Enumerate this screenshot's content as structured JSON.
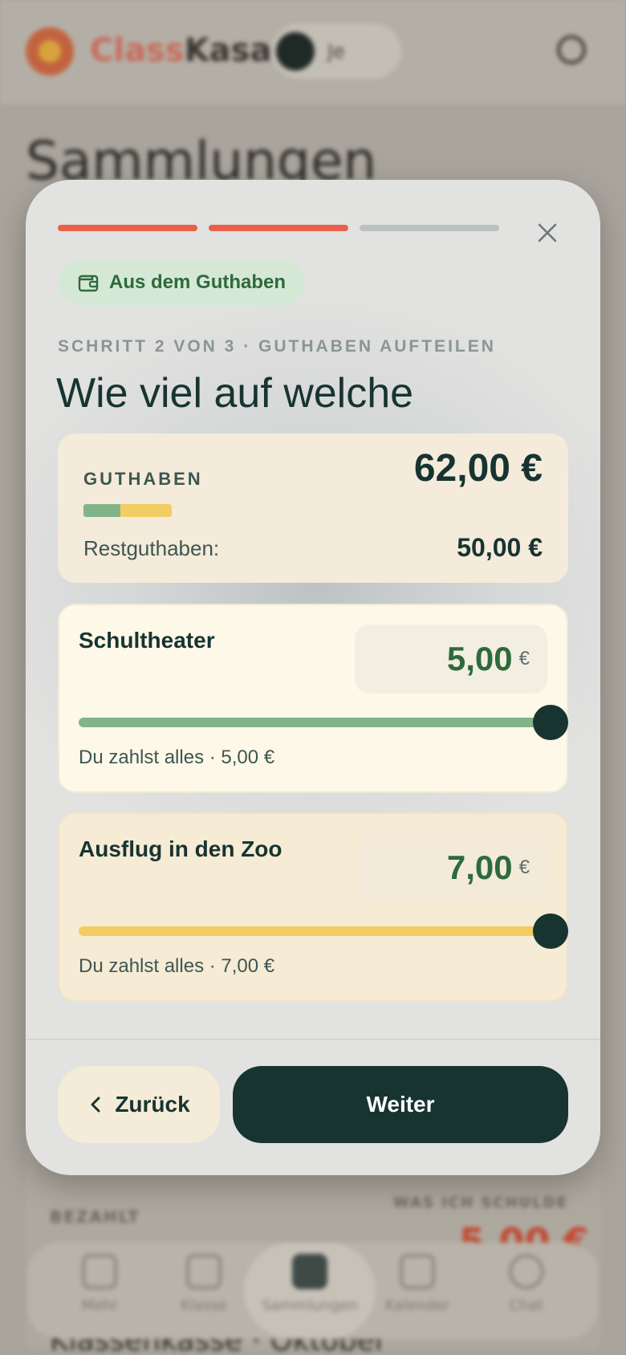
{
  "background": {
    "logo_part1": "Class",
    "logo_part2": "Kasa",
    "profile_pill_text": "Je",
    "page_title": "Sammlungen",
    "summary_left_label": "BEZAHLT",
    "summary_right_label": "WAS ICH SCHULDE",
    "summary_right_value": "5,00 €",
    "card_title": "Klassenkasse · Oktober",
    "nav": [
      {
        "label": "Mehr",
        "icon": "menu-icon"
      },
      {
        "label": "Klasse",
        "icon": "class-icon"
      },
      {
        "label": "Sammlungen",
        "icon": "collections-icon"
      },
      {
        "label": "Kalender",
        "icon": "calendar-icon"
      },
      {
        "label": "Chat",
        "icon": "chat-icon"
      }
    ]
  },
  "modal": {
    "progress": {
      "total_steps": 3,
      "completed_steps": 2
    },
    "colors": {
      "accent": "#e8604a",
      "inactive": "#b9c2c0",
      "primary": "#173431",
      "green": "#82b48a",
      "yellow": "#f2cd62"
    },
    "source_label": "Aus dem Guthaben",
    "step_label": "SCHRITT 2 VON 3 · GUTHABEN AUFTEILEN",
    "heading": "Wie viel auf welche",
    "balance": {
      "label": "GUTHABEN",
      "value": "62,00 €",
      "rest_label": "Restguthaben:",
      "rest_value": "50,00 €",
      "bar_fraction_green": 0.42,
      "bar_fraction_yellow": 0.58
    },
    "allocations": [
      {
        "name": "Schultheater",
        "amount": "5,00",
        "currency": "€",
        "hint": "Du zahlst alles · 5,00 €",
        "slider_fraction": 1.0
      },
      {
        "name": "Ausflug in den Zoo",
        "amount": "7,00",
        "currency": "€",
        "hint": "Du zahlst alles · 7,00 €",
        "slider_fraction": 1.0
      }
    ],
    "back_label": "Zurück",
    "next_label": "Weiter"
  }
}
